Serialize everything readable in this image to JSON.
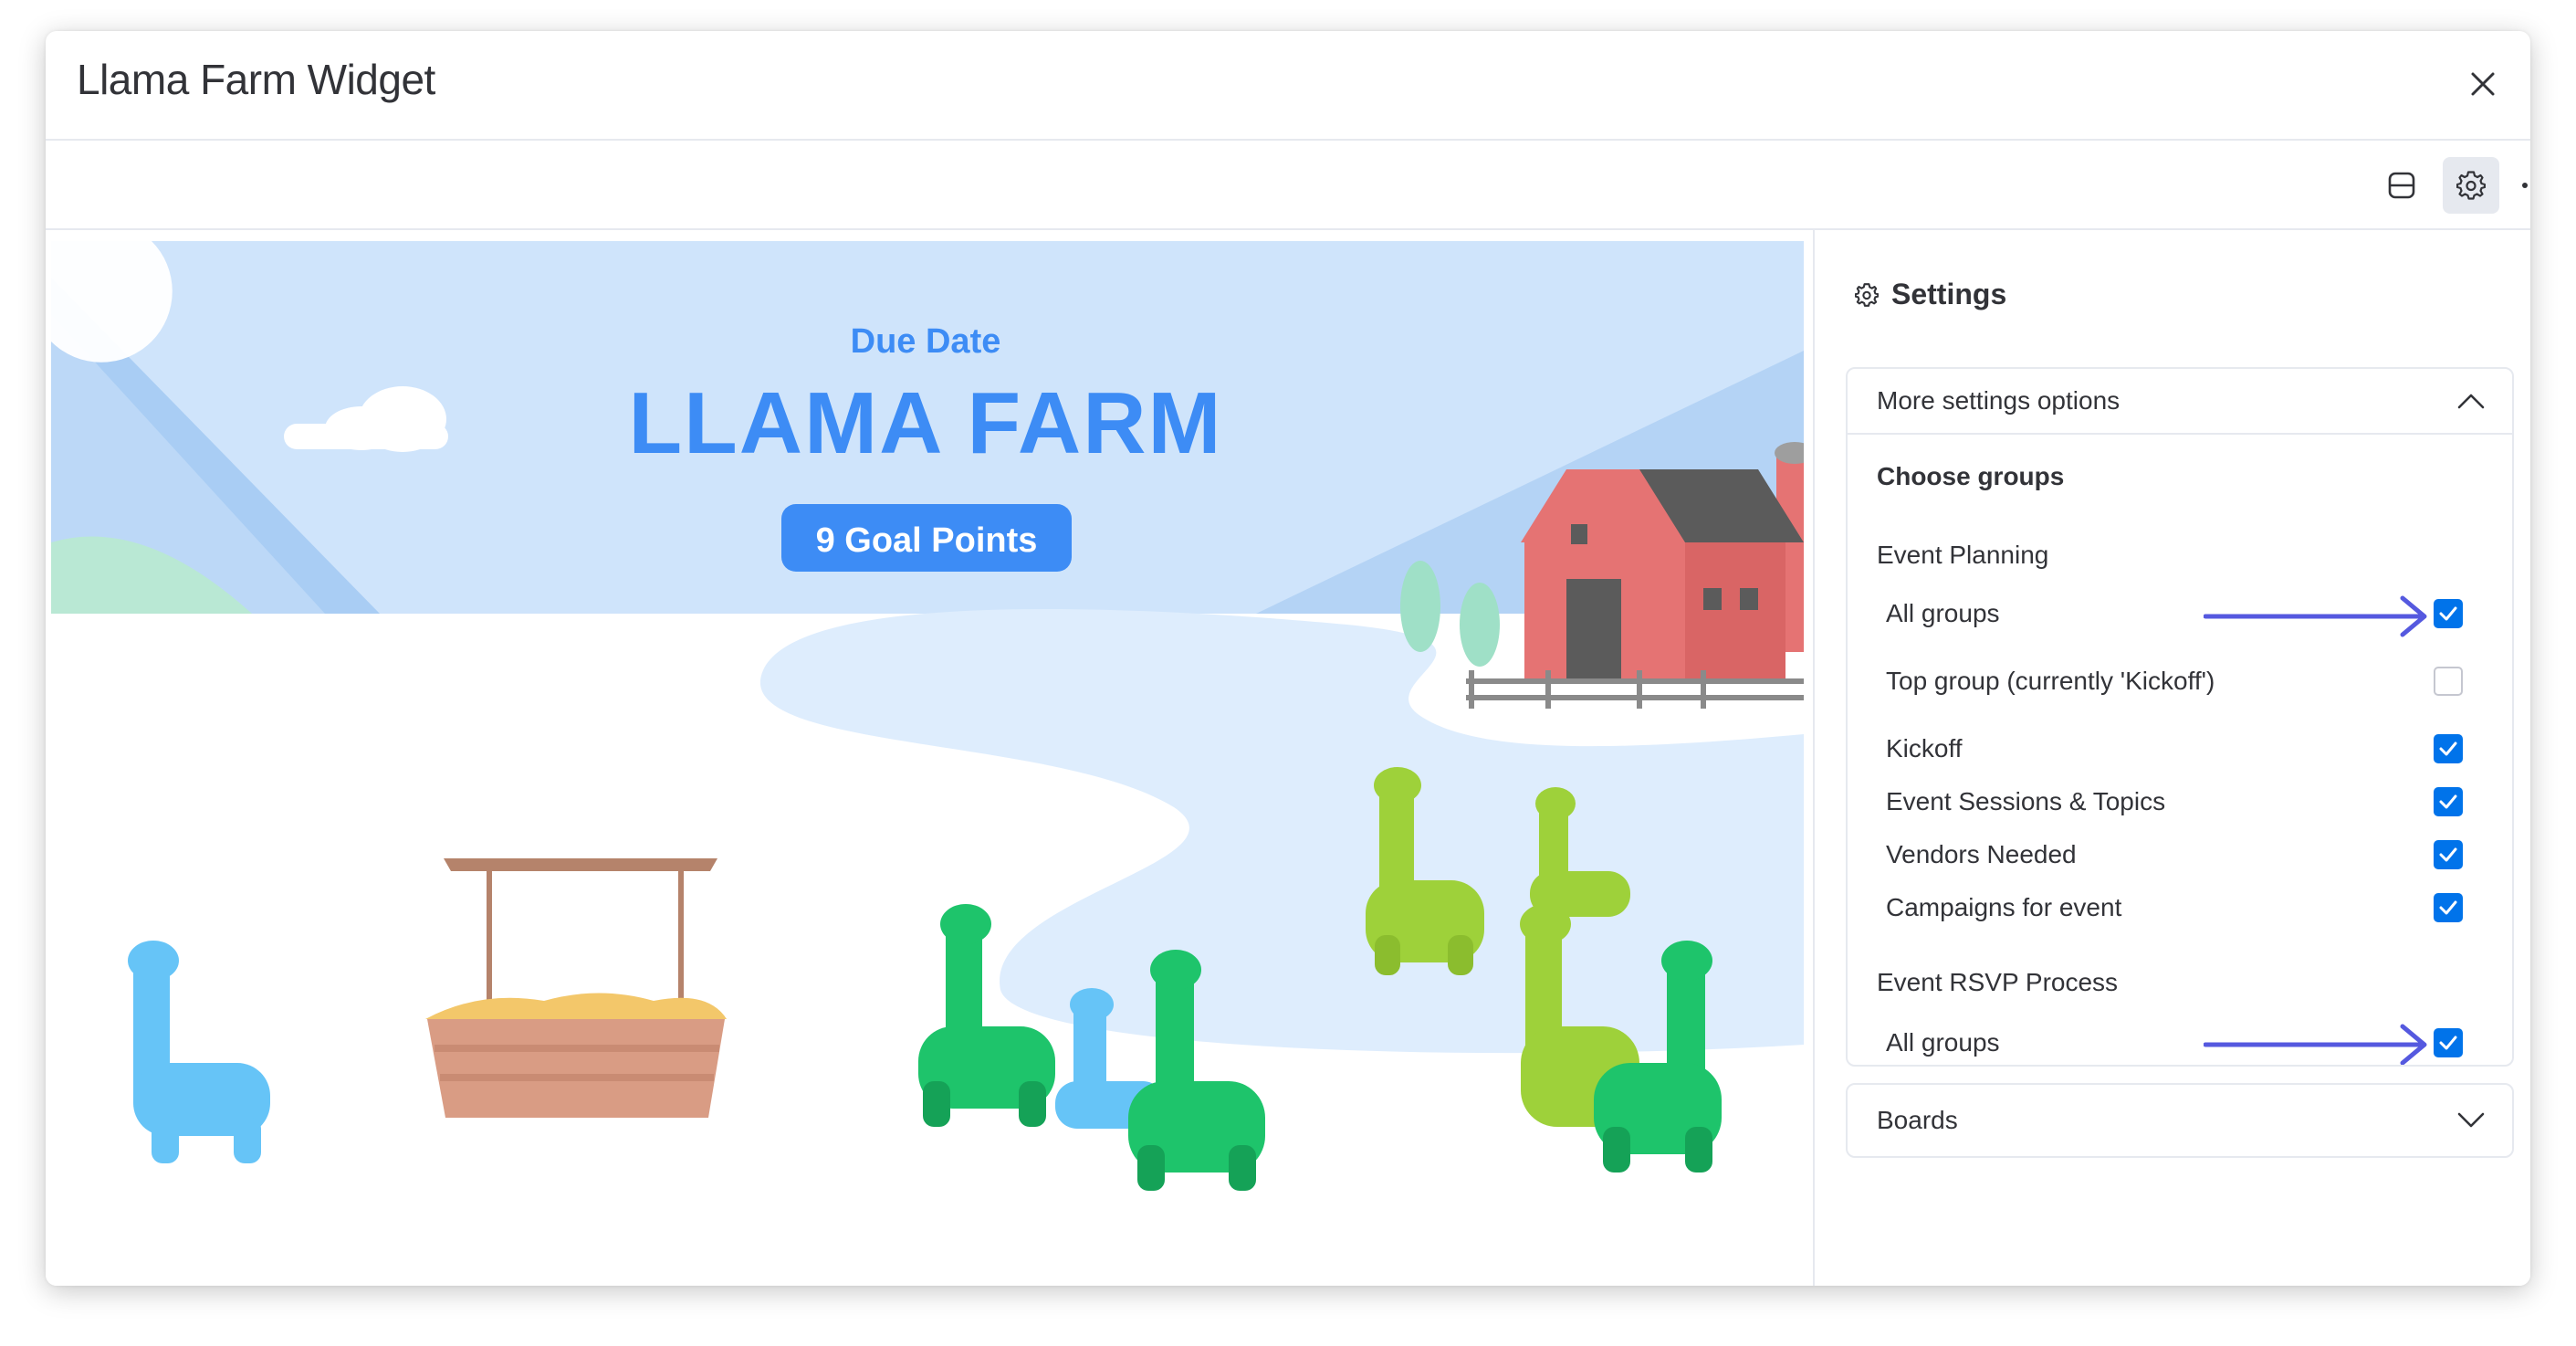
{
  "window": {
    "title": "Llama Farm Widget"
  },
  "toolbar": {
    "icons": [
      "layout-icon",
      "gear-icon",
      "more-icon"
    ]
  },
  "banner": {
    "subtitle": "Due Date",
    "title": "LLAMA FARM",
    "badge": "9 Goal Points"
  },
  "colors": {
    "accent": "#0073ea",
    "arrow": "#5559df",
    "sky": "#cfe4fb",
    "banner_text": "#3d8cf5"
  },
  "settings": {
    "title": "Settings",
    "more_options": {
      "label": "More settings options",
      "choose_groups": "Choose groups",
      "boards": [
        {
          "name": "Event Planning",
          "groups": [
            {
              "label": "All groups",
              "checked": true
            },
            {
              "label": "Top group (currently 'Kickoff')",
              "checked": false
            },
            {
              "label": "Kickoff",
              "checked": true
            },
            {
              "label": "Event Sessions & Topics",
              "checked": true
            },
            {
              "label": "Vendors Needed",
              "checked": true
            },
            {
              "label": "Campaigns for event",
              "checked": true
            }
          ]
        },
        {
          "name": "Event RSVP Process",
          "groups": [
            {
              "label": "All groups",
              "checked": true
            }
          ]
        }
      ]
    },
    "boards_label": "Boards"
  }
}
